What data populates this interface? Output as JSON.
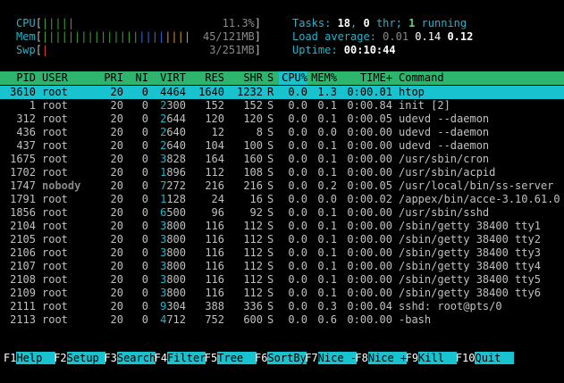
{
  "meters": {
    "cpu": {
      "label": "CPU",
      "bars_green": "|||||",
      "bars_blue": "",
      "bars_orange": "",
      "value": "11.3%"
    },
    "mem": {
      "label": "Mem",
      "bars_green": "|||||||||||||||",
      "bars_blue": "||||",
      "bars_orange": "||||",
      "value": "45/121MB"
    },
    "swp": {
      "label": "Swp",
      "bars_green": "",
      "bars_blue": "",
      "bars_orange": "",
      "value": "3/251MB"
    }
  },
  "stats": {
    "tasks_label": "Tasks: ",
    "tasks_count": "18",
    "tasks_sep": ", ",
    "threads_count": "0",
    "threads_label": " thr; ",
    "running_count": "1",
    "running_label": " running",
    "load_label": "Load average: ",
    "load1": "0.01",
    "load5": "0.14",
    "load15": "0.12",
    "uptime_label": "Uptime: ",
    "uptime": "00:10:44"
  },
  "header": {
    "pid": "PID",
    "user": "USER",
    "pri": "PRI",
    "ni": "NI",
    "virt": "VIRT",
    "res": "RES",
    "shr": "SHR",
    "s": "S",
    "cpu": "CPU%",
    "mem": "MEM%",
    "time": "TIME+",
    "command": "Command"
  },
  "processes": [
    {
      "pid": "3610",
      "user": "root",
      "pri": "20",
      "ni": "0",
      "virt_hi": "4",
      "virt": "464",
      "res": "1640",
      "shr": "1232",
      "s": "R",
      "cpu": "0.0",
      "mem": "1.3",
      "time": "0:00.01",
      "cmd": "htop"
    },
    {
      "pid": "1",
      "user": "root",
      "pri": "20",
      "ni": "0",
      "virt_hi": "2",
      "virt": "300",
      "res": "152",
      "shr": "152",
      "s": "S",
      "cpu": "0.0",
      "mem": "0.1",
      "time": "0:00.84",
      "cmd": "init [2]"
    },
    {
      "pid": "312",
      "user": "root",
      "pri": "20",
      "ni": "0",
      "virt_hi": "2",
      "virt": "644",
      "res": "120",
      "shr": "120",
      "s": "S",
      "cpu": "0.0",
      "mem": "0.1",
      "time": "0:00.05",
      "cmd": "udevd --daemon"
    },
    {
      "pid": "436",
      "user": "root",
      "pri": "20",
      "ni": "0",
      "virt_hi": "2",
      "virt": "640",
      "res": "12",
      "shr": "8",
      "s": "S",
      "cpu": "0.0",
      "mem": "0.0",
      "time": "0:00.00",
      "cmd": "udevd --daemon"
    },
    {
      "pid": "437",
      "user": "root",
      "pri": "20",
      "ni": "0",
      "virt_hi": "2",
      "virt": "640",
      "res": "104",
      "shr": "100",
      "s": "S",
      "cpu": "0.0",
      "mem": "0.1",
      "time": "0:00.00",
      "cmd": "udevd --daemon"
    },
    {
      "pid": "1675",
      "user": "root",
      "pri": "20",
      "ni": "0",
      "virt_hi": "3",
      "virt": "828",
      "res": "164",
      "shr": "160",
      "s": "S",
      "cpu": "0.0",
      "mem": "0.1",
      "time": "0:00.00",
      "cmd": "/usr/sbin/cron"
    },
    {
      "pid": "1702",
      "user": "root",
      "pri": "20",
      "ni": "0",
      "virt_hi": "1",
      "virt": "896",
      "res": "112",
      "shr": "108",
      "s": "S",
      "cpu": "0.0",
      "mem": "0.1",
      "time": "0:00.00",
      "cmd": "/usr/sbin/acpid"
    },
    {
      "pid": "1747",
      "user": "nobody",
      "pri": "20",
      "ni": "0",
      "virt_hi": "7",
      "virt": "272",
      "res": "216",
      "shr": "216",
      "s": "S",
      "cpu": "0.0",
      "mem": "0.2",
      "time": "0:00.05",
      "cmd": "/usr/local/bin/ss-server"
    },
    {
      "pid": "1791",
      "user": "root",
      "pri": "20",
      "ni": "0",
      "virt_hi": "1",
      "virt": "128",
      "res": "24",
      "shr": "16",
      "s": "S",
      "cpu": "0.0",
      "mem": "0.0",
      "time": "0:00.02",
      "cmd": "/appex/bin/acce-3.10.61.0"
    },
    {
      "pid": "1856",
      "user": "root",
      "pri": "20",
      "ni": "0",
      "virt_hi": "6",
      "virt": "500",
      "res": "96",
      "shr": "92",
      "s": "S",
      "cpu": "0.0",
      "mem": "0.1",
      "time": "0:00.00",
      "cmd": "/usr/sbin/sshd"
    },
    {
      "pid": "2104",
      "user": "root",
      "pri": "20",
      "ni": "0",
      "virt_hi": "3",
      "virt": "800",
      "res": "116",
      "shr": "112",
      "s": "S",
      "cpu": "0.0",
      "mem": "0.1",
      "time": "0:00.00",
      "cmd": "/sbin/getty 38400 tty1"
    },
    {
      "pid": "2105",
      "user": "root",
      "pri": "20",
      "ni": "0",
      "virt_hi": "3",
      "virt": "800",
      "res": "116",
      "shr": "112",
      "s": "S",
      "cpu": "0.0",
      "mem": "0.1",
      "time": "0:00.00",
      "cmd": "/sbin/getty 38400 tty2"
    },
    {
      "pid": "2106",
      "user": "root",
      "pri": "20",
      "ni": "0",
      "virt_hi": "3",
      "virt": "800",
      "res": "116",
      "shr": "112",
      "s": "S",
      "cpu": "0.0",
      "mem": "0.1",
      "time": "0:00.00",
      "cmd": "/sbin/getty 38400 tty3"
    },
    {
      "pid": "2107",
      "user": "root",
      "pri": "20",
      "ni": "0",
      "virt_hi": "3",
      "virt": "800",
      "res": "116",
      "shr": "112",
      "s": "S",
      "cpu": "0.0",
      "mem": "0.1",
      "time": "0:00.00",
      "cmd": "/sbin/getty 38400 tty4"
    },
    {
      "pid": "2108",
      "user": "root",
      "pri": "20",
      "ni": "0",
      "virt_hi": "3",
      "virt": "800",
      "res": "116",
      "shr": "112",
      "s": "S",
      "cpu": "0.0",
      "mem": "0.1",
      "time": "0:00.00",
      "cmd": "/sbin/getty 38400 tty5"
    },
    {
      "pid": "2109",
      "user": "root",
      "pri": "20",
      "ni": "0",
      "virt_hi": "3",
      "virt": "800",
      "res": "116",
      "shr": "112",
      "s": "S",
      "cpu": "0.0",
      "mem": "0.1",
      "time": "0:00.00",
      "cmd": "/sbin/getty 38400 tty6"
    },
    {
      "pid": "2111",
      "user": "root",
      "pri": "20",
      "ni": "0",
      "virt_hi": "9",
      "virt": "304",
      "res": "388",
      "shr": "336",
      "s": "S",
      "cpu": "0.0",
      "mem": "0.3",
      "time": "0:00.04",
      "cmd": "sshd: root@pts/0"
    },
    {
      "pid": "2113",
      "user": "root",
      "pri": "20",
      "ni": "0",
      "virt_hi": "4",
      "virt": "712",
      "res": "752",
      "shr": "600",
      "s": "S",
      "cpu": "0.0",
      "mem": "0.6",
      "time": "0:00.00",
      "cmd": "-bash"
    }
  ],
  "footer": [
    {
      "key": "F1",
      "label": "Help  "
    },
    {
      "key": "F2",
      "label": "Setup "
    },
    {
      "key": "F3",
      "label": "Search"
    },
    {
      "key": "F4",
      "label": "Filter"
    },
    {
      "key": "F5",
      "label": "Tree  "
    },
    {
      "key": "F6",
      "label": "SortBy"
    },
    {
      "key": "F7",
      "label": "Nice -"
    },
    {
      "key": "F8",
      "label": "Nice +"
    },
    {
      "key": "F9",
      "label": "Kill  "
    },
    {
      "key": "F10",
      "label": "Quit  "
    }
  ],
  "colors": {
    "background": "#000000",
    "header_bg": "#2db56d",
    "selection_bg": "#19c2cf",
    "label_cyan": "#27b3c9"
  }
}
